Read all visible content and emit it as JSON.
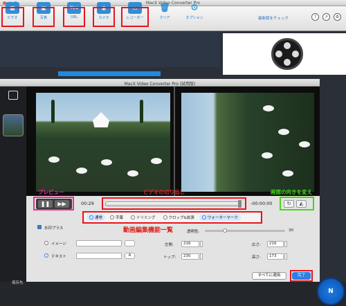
{
  "app": {
    "title": "MacX Video Converter Pro"
  },
  "toolbar": {
    "items": [
      {
        "label": "ビデオ",
        "icon": "add-video-icon"
      },
      {
        "label": "写真",
        "icon": "photo-icon"
      },
      {
        "label": "URL",
        "icon": "youtube-url-icon"
      },
      {
        "label": "カメラ",
        "icon": "camera-icon"
      },
      {
        "label": "レコーダー",
        "icon": "screen-recorder-icon"
      },
      {
        "label": "クリア",
        "icon": "trash-icon"
      },
      {
        "label": "オプション",
        "icon": "gear-icon"
      }
    ],
    "update_link": "最新版をチェック",
    "youtube_glyph": "You"
  },
  "dialog": {
    "title": "MacX Video Converter Pro (試用版)",
    "time_current": "00:29",
    "time_remaining": "-00:00:00",
    "tabs": [
      {
        "label": "通常",
        "active": true
      },
      {
        "label": "字幕",
        "active": false
      },
      {
        "label": "トリミング",
        "active": false
      },
      {
        "label": "クロップ&拡張",
        "active": false
      },
      {
        "label": "ウォーターマーク",
        "active": true
      }
    ],
    "watermark": {
      "enable_label": "水印プラス",
      "image_label": "イメージ",
      "text_label": "テキスト",
      "text_button": "A",
      "opacity_label": "透明性:",
      "opacity_value": "30",
      "left_label": "左側:",
      "left_value": "216",
      "top_label": "トップ:",
      "top_value": "230",
      "width_label": "広さ:",
      "width_value": "216",
      "height_label": "高さ:",
      "height_value": "173"
    },
    "apply_all": "すべてに適用",
    "done": "完了"
  },
  "annotations": {
    "preview": "プレビュー",
    "trim": "ビデオの切り出し",
    "rotate": "画面の向きを変え",
    "edit_features": "動画編集機能一覧"
  },
  "footer": {
    "save_label": "保存先",
    "run_label": "N"
  },
  "colors": {
    "annotation_red": "#e2242c",
    "annotation_pink": "#ee2c9a",
    "annotation_green": "#45d81a",
    "accent_blue": "#2f7fe0"
  }
}
